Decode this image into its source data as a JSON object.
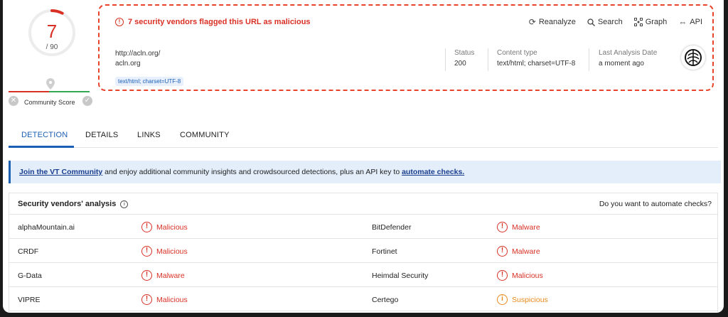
{
  "score": {
    "value": "7",
    "total": "/ 90",
    "fraction": 0.078
  },
  "community": {
    "label": "Community Score",
    "down_icon": "x-icon",
    "up_icon": "check-icon"
  },
  "header": {
    "alert": "7 security vendors flagged this URL as malicious",
    "actions": [
      {
        "label": "Reanalyze",
        "icon": "refresh-icon"
      },
      {
        "label": "Search",
        "icon": "search-icon"
      },
      {
        "label": "Graph",
        "icon": "graph-icon"
      },
      {
        "label": "API",
        "icon": "api-icon"
      }
    ],
    "url": "http://acln.org/",
    "domain": "acln.org",
    "tag": "text/html; charset=UTF-8",
    "status_label": "Status",
    "status_value": "200",
    "content_label": "Content type",
    "content_value": "text/html; charset=UTF-8",
    "last_label": "Last Analysis Date",
    "last_value": "a moment ago"
  },
  "tabs": [
    "DETECTION",
    "DETAILS",
    "LINKS",
    "COMMUNITY"
  ],
  "banner": {
    "link1": "Join the VT Community",
    "text": " and enjoy additional community insights and crowdsourced detections, plus an API key to ",
    "link2": "automate checks."
  },
  "table": {
    "title": "Security vendors' analysis",
    "right": "Do you want to automate checks?",
    "rows": [
      {
        "v1": "alphaMountain.ai",
        "r1": "Malicious",
        "v2": "BitDefender",
        "r2": "Malware"
      },
      {
        "v1": "CRDF",
        "r1": "Malicious",
        "v2": "Fortinet",
        "r2": "Malware"
      },
      {
        "v1": "G-Data",
        "r1": "Malware",
        "v2": "Heimdal Security",
        "r2": "Malicious"
      },
      {
        "v1": "VIPRE",
        "r1": "Malicious",
        "v2": "Certego",
        "r2": "Suspicious"
      }
    ]
  },
  "colors": {
    "danger": "#d93025",
    "warning": "#e8891a",
    "accent": "#1a5fb4",
    "highlight": "#e8442c"
  }
}
